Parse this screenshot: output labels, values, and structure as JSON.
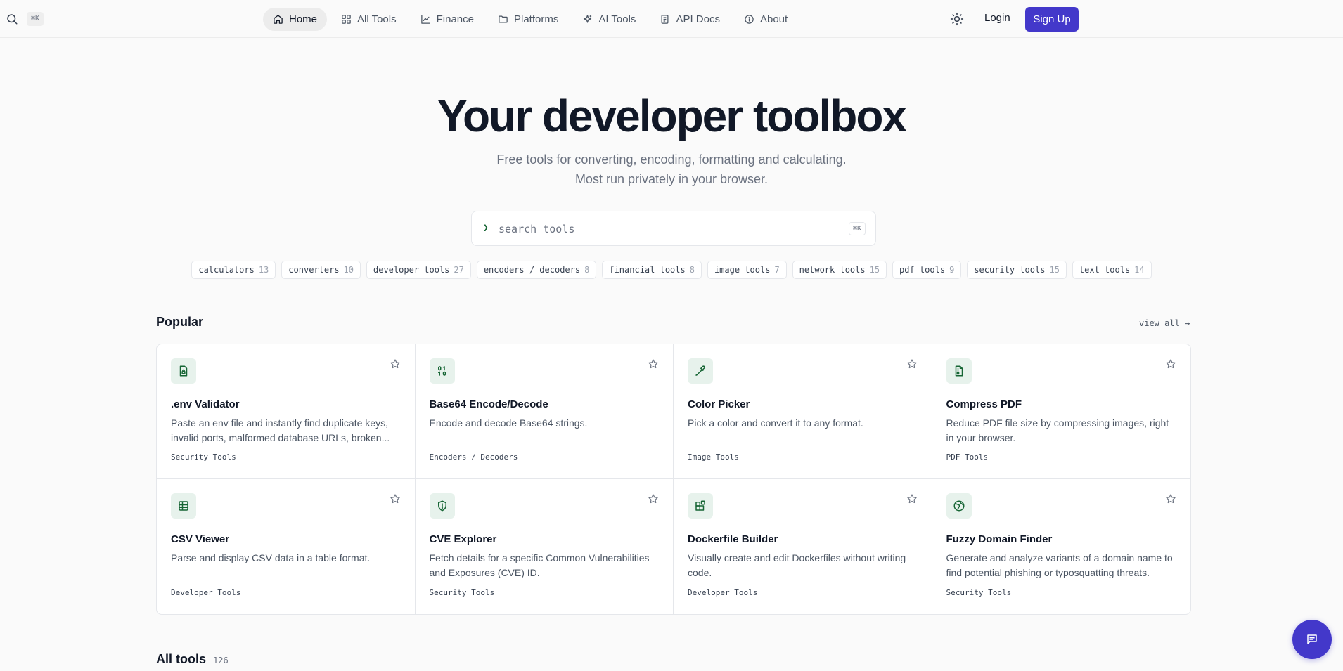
{
  "topbar": {
    "shortcut": "⌘K"
  },
  "nav": [
    {
      "label": "Home",
      "icon": "home-icon",
      "active": true
    },
    {
      "label": "All Tools",
      "icon": "grid-icon"
    },
    {
      "label": "Finance",
      "icon": "chart-line-icon"
    },
    {
      "label": "Platforms",
      "icon": "folder-icon"
    },
    {
      "label": "AI Tools",
      "icon": "sparkles-icon"
    },
    {
      "label": "API Docs",
      "icon": "document-icon"
    },
    {
      "label": "About",
      "icon": "info-icon"
    }
  ],
  "auth": {
    "login": "Login",
    "signup": "Sign Up"
  },
  "hero": {
    "title": "Your developer toolbox",
    "subtitle": "Free tools for converting, encoding, formatting and calculating. Most run privately in your browser."
  },
  "search": {
    "prompt": "❯",
    "placeholder": "search tools",
    "shortcut": "⌘K"
  },
  "categories": [
    {
      "name": "calculators",
      "count": "13"
    },
    {
      "name": "converters",
      "count": "10"
    },
    {
      "name": "developer tools",
      "count": "27"
    },
    {
      "name": "encoders / decoders",
      "count": "8"
    },
    {
      "name": "financial tools",
      "count": "8"
    },
    {
      "name": "image tools",
      "count": "7"
    },
    {
      "name": "network tools",
      "count": "15"
    },
    {
      "name": "pdf tools",
      "count": "9"
    },
    {
      "name": "security tools",
      "count": "15"
    },
    {
      "name": "text tools",
      "count": "14"
    }
  ],
  "popular": {
    "title": "Popular",
    "view_all": "view all →",
    "tools": [
      {
        "title": ".env Validator",
        "desc": "Paste an env file and instantly find duplicate keys, invalid ports, malformed database URLs, broken...",
        "category": "Security Tools",
        "icon": "file-lock-icon"
      },
      {
        "title": "Base64 Encode/Decode",
        "desc": "Encode and decode Base64 strings.",
        "category": "Encoders / Decoders",
        "icon": "binary-icon"
      },
      {
        "title": "Color Picker",
        "desc": "Pick a color and convert it to any format.",
        "category": "Image Tools",
        "icon": "pipette-icon"
      },
      {
        "title": "Compress PDF",
        "desc": "Reduce PDF file size by compressing images, right in your browser.",
        "category": "PDF Tools",
        "icon": "file-archive-icon"
      },
      {
        "title": "CSV Viewer",
        "desc": "Parse and display CSV data in a table format.",
        "category": "Developer Tools",
        "icon": "table-icon"
      },
      {
        "title": "CVE Explorer",
        "desc": "Fetch details for a specific Common Vulnerabilities and Exposures (CVE) ID.",
        "category": "Security Tools",
        "icon": "shield-alert-icon"
      },
      {
        "title": "Dockerfile Builder",
        "desc": "Visually create and edit Dockerfiles without writing code.",
        "category": "Developer Tools",
        "icon": "blocks-icon"
      },
      {
        "title": "Fuzzy Domain Finder",
        "desc": "Generate and analyze variants of a domain name to find potential phishing or typosquatting threats.",
        "category": "Security Tools",
        "icon": "globe-icon"
      }
    ]
  },
  "all_tools": {
    "title": "All tools",
    "count": "126"
  }
}
